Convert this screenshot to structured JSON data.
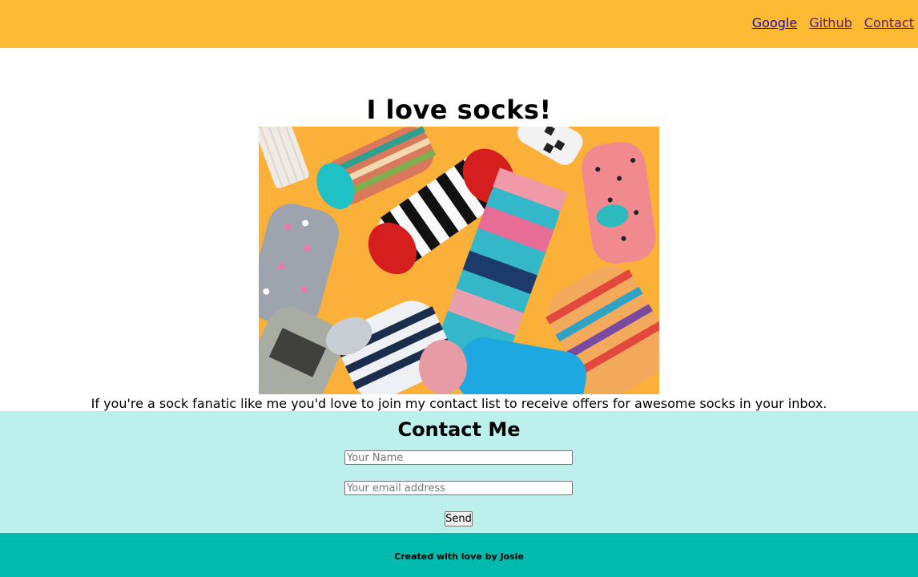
{
  "nav": {
    "links": [
      {
        "label": "Google"
      },
      {
        "label": "Github"
      },
      {
        "label": "Contact"
      }
    ]
  },
  "hero": {
    "title": "I love socks!",
    "intro": "If you're a sock fanatic like me you'd love to join my contact list to receive offers for awesome socks in your inbox."
  },
  "contact": {
    "heading": "Contact Me",
    "name_placeholder": "Your Name",
    "email_placeholder": "Your email address",
    "send_label": "Send"
  },
  "footer": {
    "text": "Created with love by Josie"
  },
  "colors": {
    "nav_bg": "#fbba32",
    "contact_bg": "#bdf0ec",
    "footer_bg": "#00bbad"
  }
}
